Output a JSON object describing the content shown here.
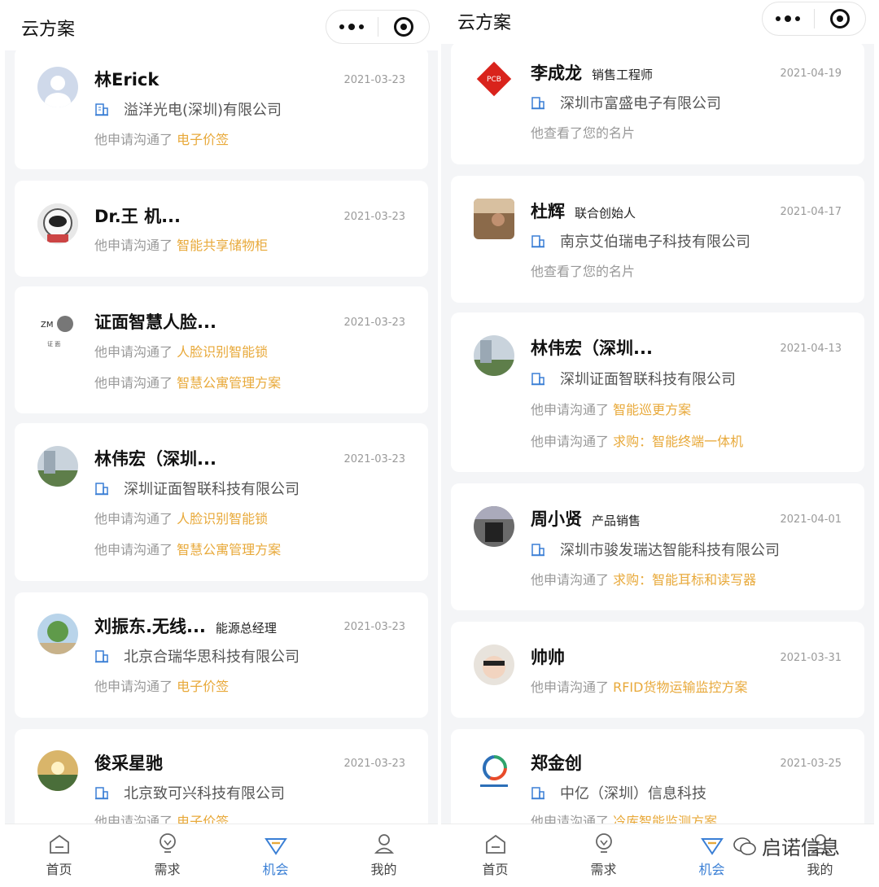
{
  "app_title": "云方案",
  "tabs": [
    {
      "label": "首页",
      "icon": "home-icon"
    },
    {
      "label": "需求",
      "icon": "bulb-icon"
    },
    {
      "label": "机会",
      "icon": "diamond-icon"
    },
    {
      "label": "我的",
      "icon": "user-icon"
    }
  ],
  "active_tab": "机会",
  "left_cards": [
    {
      "name": "林Erick",
      "date": "2021-03-23",
      "company": "溢洋光电(深圳)有限公司",
      "lines": [
        {
          "prefix": "他申请沟通了",
          "highlight": "电子价签"
        }
      ]
    },
    {
      "name": "Dr.王 机...",
      "date": "2021-03-23",
      "lines": [
        {
          "prefix": "他申请沟通了",
          "highlight": "智能共享储物柜"
        }
      ]
    },
    {
      "name": "证面智慧人脸...",
      "date": "2021-03-23",
      "lines": [
        {
          "prefix": "他申请沟通了",
          "highlight": "人脸识别智能锁"
        },
        {
          "prefix": "他申请沟通了",
          "highlight": "智慧公寓管理方案"
        }
      ]
    },
    {
      "name": "林伟宏（深圳...",
      "date": "2021-03-23",
      "company": "深圳证面智联科技有限公司",
      "lines": [
        {
          "prefix": "他申请沟通了",
          "highlight": "人脸识别智能锁"
        },
        {
          "prefix": "他申请沟通了",
          "highlight": "智慧公寓管理方案"
        }
      ]
    },
    {
      "name": "刘振东.无线...",
      "role": "能源总经理",
      "date": "2021-03-23",
      "company": "北京合瑞华思科技有限公司",
      "lines": [
        {
          "prefix": "他申请沟通了",
          "highlight": "电子价签"
        }
      ]
    },
    {
      "name": "俊采星驰",
      "date": "2021-03-23",
      "company": "北京致可兴科技有限公司",
      "lines": [
        {
          "prefix": "他申请沟通了",
          "highlight": "电子价签"
        }
      ]
    }
  ],
  "right_cards": [
    {
      "name": "李成龙",
      "role": "销售工程师",
      "date": "2021-04-19",
      "company": "深圳市富盛电子有限公司",
      "lines": [
        {
          "prefix": "他查看了您的名片",
          "highlight": ""
        }
      ],
      "logo_text": "PCB"
    },
    {
      "name": "杜辉",
      "role": "联合创始人",
      "date": "2021-04-17",
      "company": "南京艾伯瑞电子科技有限公司",
      "lines": [
        {
          "prefix": "他查看了您的名片",
          "highlight": ""
        }
      ]
    },
    {
      "name": "林伟宏（深圳...",
      "date": "2021-04-13",
      "company": "深圳证面智联科技有限公司",
      "lines": [
        {
          "prefix": "他申请沟通了",
          "highlight": "智能巡更方案"
        },
        {
          "prefix": "他申请沟通了",
          "highlight": "求购：智能终端一体机"
        }
      ]
    },
    {
      "name": "周小贤",
      "role": "产品销售",
      "date": "2021-04-01",
      "company": "深圳市骏发瑞达智能科技有限公司",
      "lines": [
        {
          "prefix": "他申请沟通了",
          "highlight": "求购：智能耳标和读写器"
        }
      ]
    },
    {
      "name": "帅帅",
      "date": "2021-03-31",
      "lines": [
        {
          "prefix": "他申请沟通了",
          "highlight": "RFID货物运输监控方案"
        }
      ]
    },
    {
      "name": "郑金创",
      "date": "2021-03-25",
      "company": "中亿（深圳）信息科技",
      "lines": [
        {
          "prefix": "他申请沟通了",
          "highlight": "冷库智能监测方案"
        }
      ]
    }
  ],
  "watermark": "启诺信息",
  "colors": {
    "highlight": "#e8a93a",
    "active_tab": "#3a7fd5",
    "date": "#9a9a9a"
  }
}
